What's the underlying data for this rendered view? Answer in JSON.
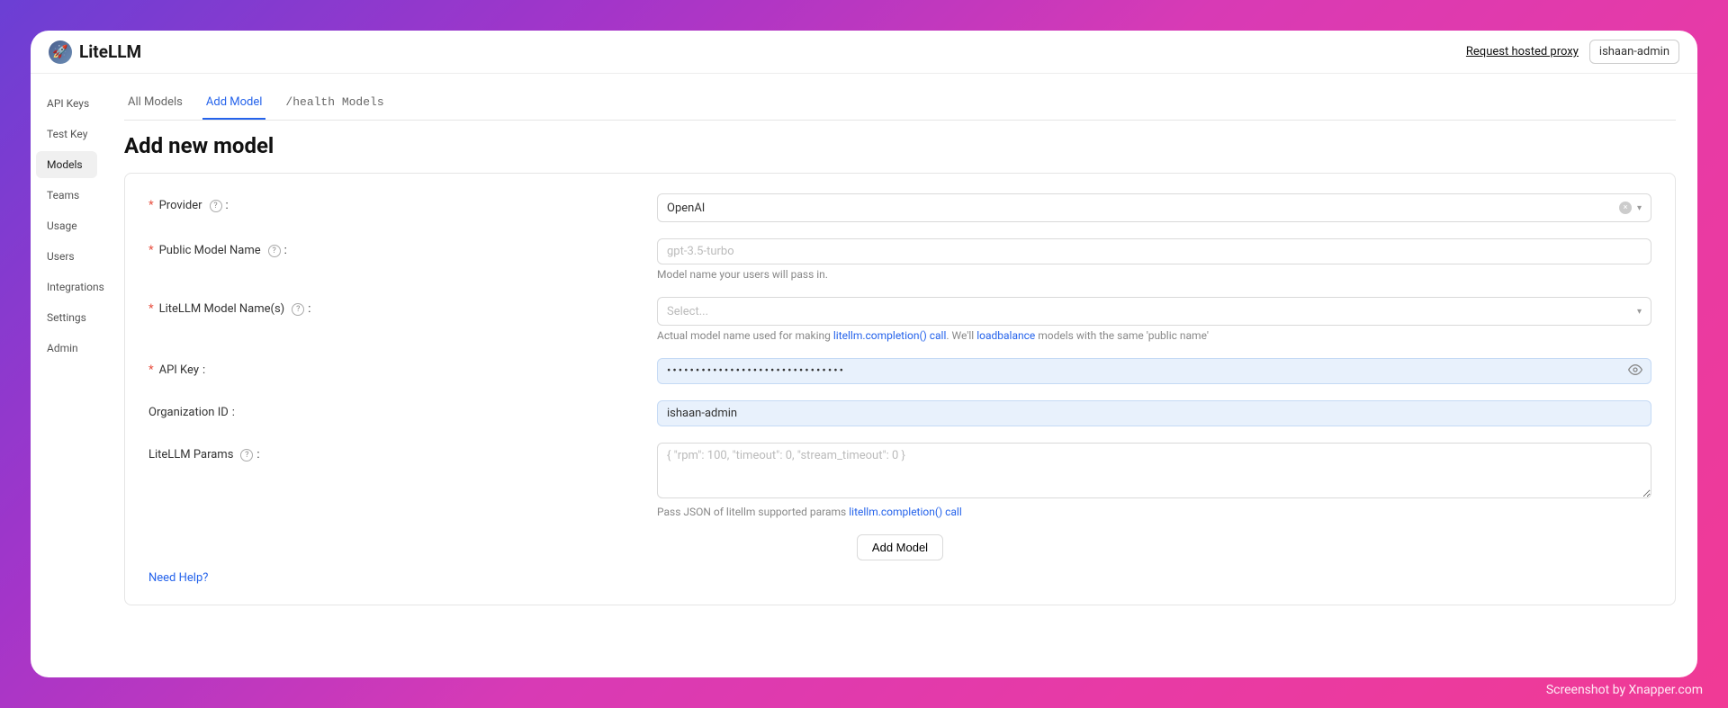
{
  "header": {
    "brand": "LiteLLM",
    "request_link": "Request hosted proxy",
    "user": "ishaan-admin"
  },
  "sidebar": {
    "items": [
      {
        "label": "API Keys"
      },
      {
        "label": "Test Key"
      },
      {
        "label": "Models",
        "active": true
      },
      {
        "label": "Teams"
      },
      {
        "label": "Usage"
      },
      {
        "label": "Users"
      },
      {
        "label": "Integrations"
      },
      {
        "label": "Settings"
      },
      {
        "label": "Admin"
      }
    ]
  },
  "tabs": {
    "items": [
      {
        "label": "All Models"
      },
      {
        "label": "Add Model",
        "active": true
      },
      {
        "label": "/health Models",
        "mono": true
      }
    ]
  },
  "page": {
    "title": "Add new model"
  },
  "form": {
    "provider": {
      "label": "Provider",
      "required": true,
      "has_help": true,
      "value": "OpenAI"
    },
    "public_model_name": {
      "label": "Public Model Name",
      "required": true,
      "has_help": true,
      "placeholder": "gpt-3.5-turbo",
      "helper": "Model name your users will pass in."
    },
    "litellm_model_names": {
      "label": "LiteLLM Model Name(s)",
      "required": true,
      "has_help": true,
      "placeholder": "Select...",
      "helper_pre": "Actual model name used for making ",
      "helper_link1": "litellm.completion() call",
      "helper_mid": ". We'll ",
      "helper_link2": "loadbalance",
      "helper_post": " models with the same 'public name'"
    },
    "api_key": {
      "label": "API Key",
      "required": true,
      "value": "•••••••••••••••••••••••••••••••"
    },
    "org_id": {
      "label": "Organization ID",
      "value": "ishaan-admin"
    },
    "litellm_params": {
      "label": "LiteLLM Params",
      "has_help": true,
      "placeholder": "{ \"rpm\": 100, \"timeout\": 0, \"stream_timeout\": 0 }",
      "helper_pre": "Pass JSON of litellm supported params ",
      "helper_link": "litellm.completion() call"
    },
    "submit": "Add Model",
    "need_help": "Need Help?"
  },
  "watermark": "Screenshot by Xnapper.com"
}
